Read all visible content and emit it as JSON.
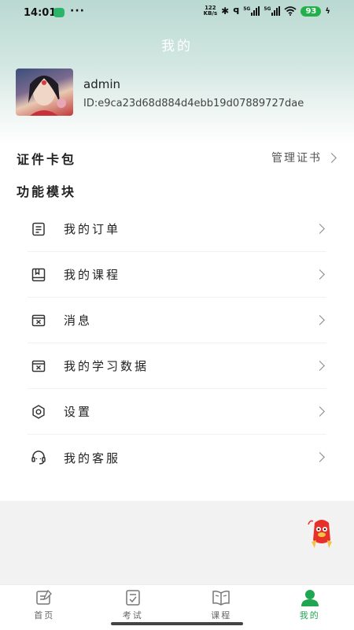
{
  "status_bar": {
    "time": "14:01",
    "network_speed_value": "122",
    "network_speed_unit": "KB/s",
    "network_type_1": "5G",
    "network_type_2": "5G",
    "battery": "93"
  },
  "header": {
    "title": "我的"
  },
  "profile": {
    "username": "admin",
    "user_id": "ID:e9ca23d68d884d4ebb19d07889727dae"
  },
  "wallet": {
    "label": "证件卡包",
    "manage_label": "管理证书"
  },
  "modules": {
    "section_title": "功能模块",
    "items": [
      {
        "label": "我的订单",
        "icon": "order-icon"
      },
      {
        "label": "我的课程",
        "icon": "course-icon"
      },
      {
        "label": "消息",
        "icon": "message-icon"
      },
      {
        "label": "我的学习数据",
        "icon": "study-data-icon"
      },
      {
        "label": "设置",
        "icon": "settings-icon"
      },
      {
        "label": "我的客服",
        "icon": "customer-service-icon"
      }
    ]
  },
  "tab_bar": {
    "tabs": [
      {
        "label": "首页",
        "icon": "home-icon",
        "active": false
      },
      {
        "label": "考试",
        "icon": "exam-icon",
        "active": false
      },
      {
        "label": "课程",
        "icon": "book-icon",
        "active": false
      },
      {
        "label": "我的",
        "icon": "profile-icon",
        "active": true
      }
    ]
  },
  "colors": {
    "accent": "#1fa650",
    "header_gradient_top": "#b9d9d1",
    "battery": "#22b04b"
  }
}
